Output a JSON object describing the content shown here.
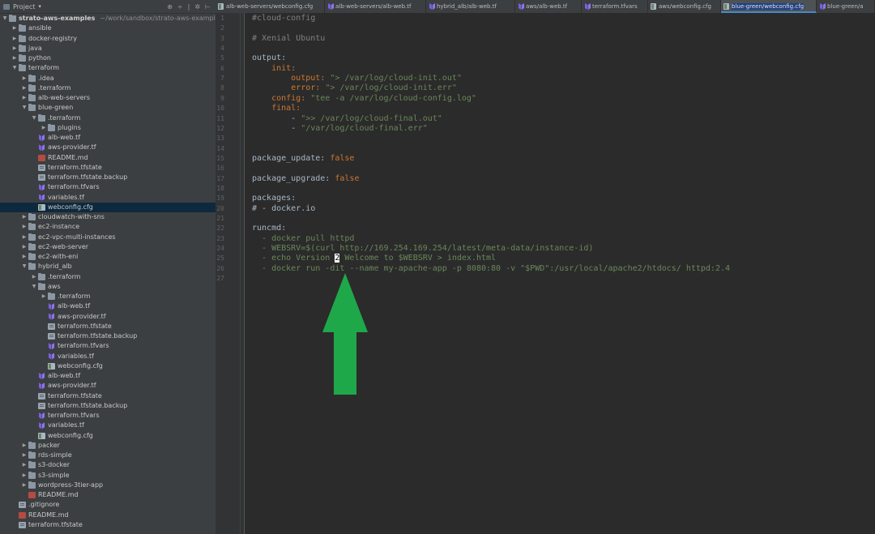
{
  "project": {
    "title": "Project",
    "root_name": "strato-aws-examples",
    "root_path": "~/work/sandbox/strato-aws-example"
  },
  "tree": [
    {
      "d": 1,
      "type": "folder",
      "open": false,
      "label": "ansible"
    },
    {
      "d": 1,
      "type": "folder",
      "open": false,
      "label": "docker-registry"
    },
    {
      "d": 1,
      "type": "folder",
      "open": false,
      "label": "java"
    },
    {
      "d": 1,
      "type": "folder",
      "open": false,
      "label": "python"
    },
    {
      "d": 1,
      "type": "folder",
      "open": true,
      "label": "terraform"
    },
    {
      "d": 2,
      "type": "folder",
      "open": false,
      "label": ".idea"
    },
    {
      "d": 2,
      "type": "folder",
      "open": false,
      "label": ".terraform"
    },
    {
      "d": 2,
      "type": "folder",
      "open": false,
      "label": "alb-web-servers"
    },
    {
      "d": 2,
      "type": "folder",
      "open": true,
      "label": "blue-green"
    },
    {
      "d": 3,
      "type": "folder",
      "open": true,
      "label": ".terraform"
    },
    {
      "d": 4,
      "type": "folder",
      "open": false,
      "label": "plugins"
    },
    {
      "d": 3,
      "type": "tf",
      "label": "alb-web.tf"
    },
    {
      "d": 3,
      "type": "tf",
      "label": "aws-provider.tf"
    },
    {
      "d": 3,
      "type": "md",
      "label": "README.md"
    },
    {
      "d": 3,
      "type": "generic",
      "label": "terraform.tfstate"
    },
    {
      "d": 3,
      "type": "generic",
      "label": "terraform.tfstate.backup"
    },
    {
      "d": 3,
      "type": "tf",
      "label": "terraform.tfvars"
    },
    {
      "d": 3,
      "type": "tf",
      "label": "variables.tf"
    },
    {
      "d": 3,
      "type": "cfg",
      "label": "webconfig.cfg",
      "selected": true
    },
    {
      "d": 2,
      "type": "folder",
      "open": false,
      "label": "cloudwatch-with-sns"
    },
    {
      "d": 2,
      "type": "folder",
      "open": false,
      "label": "ec2-instance"
    },
    {
      "d": 2,
      "type": "folder",
      "open": false,
      "label": "ec2-vpc-multi-instances"
    },
    {
      "d": 2,
      "type": "folder",
      "open": false,
      "label": "ec2-web-server"
    },
    {
      "d": 2,
      "type": "folder",
      "open": false,
      "label": "ec2-with-eni"
    },
    {
      "d": 2,
      "type": "folder",
      "open": true,
      "label": "hybrid_alb"
    },
    {
      "d": 3,
      "type": "folder",
      "open": false,
      "label": ".terraform"
    },
    {
      "d": 3,
      "type": "folder",
      "open": true,
      "label": "aws"
    },
    {
      "d": 4,
      "type": "folder",
      "open": false,
      "label": ".terraform"
    },
    {
      "d": 4,
      "type": "tf",
      "label": "alb-web.tf"
    },
    {
      "d": 4,
      "type": "tf",
      "label": "aws-provider.tf"
    },
    {
      "d": 4,
      "type": "generic",
      "label": "terraform.tfstate"
    },
    {
      "d": 4,
      "type": "generic",
      "label": "terraform.tfstate.backup"
    },
    {
      "d": 4,
      "type": "tf",
      "label": "terraform.tfvars"
    },
    {
      "d": 4,
      "type": "tf",
      "label": "variables.tf"
    },
    {
      "d": 4,
      "type": "cfg",
      "label": "webconfig.cfg"
    },
    {
      "d": 3,
      "type": "tf",
      "label": "alb-web.tf"
    },
    {
      "d": 3,
      "type": "tf",
      "label": "aws-provider.tf"
    },
    {
      "d": 3,
      "type": "generic",
      "label": "terraform.tfstate"
    },
    {
      "d": 3,
      "type": "generic",
      "label": "terraform.tfstate.backup"
    },
    {
      "d": 3,
      "type": "tf",
      "label": "terraform.tfvars"
    },
    {
      "d": 3,
      "type": "tf",
      "label": "variables.tf"
    },
    {
      "d": 3,
      "type": "cfg",
      "label": "webconfig.cfg"
    },
    {
      "d": 2,
      "type": "folder",
      "open": false,
      "label": "packer"
    },
    {
      "d": 2,
      "type": "folder",
      "open": false,
      "label": "rds-simple"
    },
    {
      "d": 2,
      "type": "folder",
      "open": false,
      "label": "s3-docker"
    },
    {
      "d": 2,
      "type": "folder",
      "open": false,
      "label": "s3-simple"
    },
    {
      "d": 2,
      "type": "folder",
      "open": false,
      "label": "wordpress-3tier-app"
    },
    {
      "d": 2,
      "type": "md",
      "label": "README.md"
    },
    {
      "d": 1,
      "type": "generic",
      "label": ".gitignore"
    },
    {
      "d": 1,
      "type": "md",
      "label": "README.md"
    },
    {
      "d": 1,
      "type": "generic",
      "label": "terraform.tfstate"
    }
  ],
  "tabs": [
    {
      "label": "alb-web-servers/webconfig.cfg",
      "type": "cfg"
    },
    {
      "label": "alb-web-servers/alb-web.tf",
      "type": "tf"
    },
    {
      "label": "hybrid_alb/alb-web.tf",
      "type": "tf"
    },
    {
      "label": "aws/alb-web.tf",
      "type": "tf"
    },
    {
      "label": "terraform.tfvars",
      "type": "tf"
    },
    {
      "label": "aws/webconfig.cfg",
      "type": "cfg"
    },
    {
      "label": "blue-green/webconfig.cfg",
      "type": "cfg",
      "active": true
    },
    {
      "label": "blue-green/a",
      "type": "tf"
    }
  ],
  "editor": {
    "lines": [
      [
        {
          "c": "com",
          "t": "#cloud-config"
        }
      ],
      [],
      [
        {
          "c": "com",
          "t": "# Xenial Ubuntu"
        }
      ],
      [],
      [
        {
          "c": "plain",
          "t": "output:"
        }
      ],
      [
        {
          "c": "key",
          "t": "    init:"
        }
      ],
      [
        {
          "c": "key",
          "t": "        output: "
        },
        {
          "c": "str",
          "t": "\"> /var/log/cloud-init.out\""
        }
      ],
      [
        {
          "c": "key",
          "t": "        error: "
        },
        {
          "c": "str",
          "t": "\"> /var/log/cloud-init.err\""
        }
      ],
      [
        {
          "c": "key",
          "t": "    config: "
        },
        {
          "c": "str",
          "t": "\"tee -a /var/log/cloud-config.log\""
        }
      ],
      [
        {
          "c": "key",
          "t": "    final:"
        }
      ],
      [
        {
          "c": "plain",
          "t": "        - "
        },
        {
          "c": "str",
          "t": "\">> /var/log/cloud-final.out\""
        }
      ],
      [
        {
          "c": "plain",
          "t": "        - "
        },
        {
          "c": "str",
          "t": "\"/var/log/cloud-final.err\""
        }
      ],
      [],
      [],
      [
        {
          "c": "plain",
          "t": "package_update: "
        },
        {
          "c": "bool",
          "t": "false"
        }
      ],
      [],
      [
        {
          "c": "plain",
          "t": "package_upgrade: "
        },
        {
          "c": "bool",
          "t": "false"
        }
      ],
      [],
      [
        {
          "c": "plain",
          "t": "packages:"
        }
      ],
      [
        {
          "c": "plain",
          "t": "# - docker.io"
        }
      ],
      [],
      [
        {
          "c": "plain",
          "t": "runcmd:"
        }
      ],
      [
        {
          "c": "str",
          "t": "  - docker pull httpd"
        }
      ],
      [
        {
          "c": "str",
          "t": "  - WEBSRV=$(curl http://169.254.169.254/latest/meta-data/instance-id)"
        }
      ],
      [
        {
          "c": "str",
          "t": "  - echo Version "
        },
        {
          "c": "cursor",
          "t": "2"
        },
        {
          "c": "str",
          "t": " Welcome to $WEBSRV > index.html"
        }
      ],
      [
        {
          "c": "str",
          "t": "  - docker run -dit --name my-apache-app -p 8080:80 -v \"$PWD\":/usr/local/apache2/htdocs/ httpd:2.4"
        }
      ],
      []
    ]
  },
  "colors": {
    "arrow": "#1fa84a",
    "selection": "#0d293e",
    "active_tab_underline": "#4a88c7"
  }
}
